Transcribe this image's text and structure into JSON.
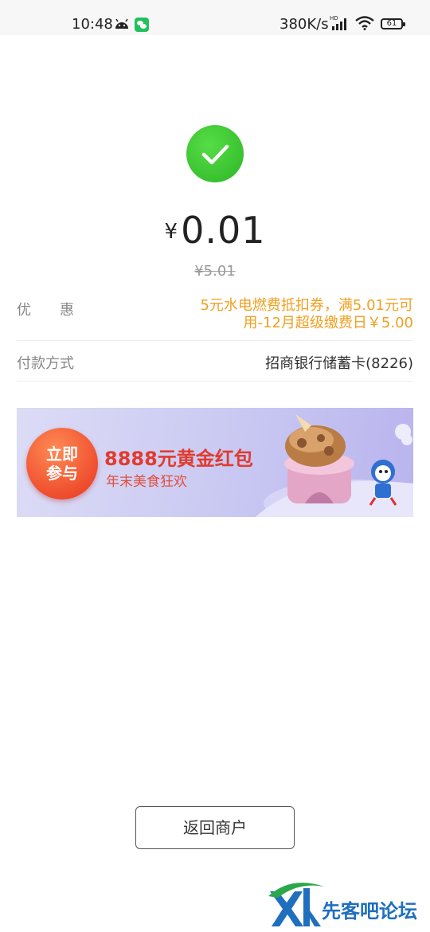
{
  "status_bar": {
    "time": "10:48",
    "network_speed": "380K/s",
    "battery": "61"
  },
  "payment": {
    "currency_symbol": "¥",
    "amount": "0.01",
    "original_amount": "¥5.01"
  },
  "discount": {
    "label": "优　　惠",
    "text": "5元水电燃费抵扣券，满5.01元可用-12月超级缴费日￥5.00"
  },
  "payment_method": {
    "label": "付款方式",
    "value": "招商银行储蓄卡(8226)"
  },
  "banner": {
    "button_text": "立即参与",
    "title": "8888元黄金红包",
    "subtitle": "年末美食狂欢"
  },
  "actions": {
    "return_label": "返回商户"
  },
  "watermark": {
    "text": "先客吧论坛"
  },
  "colors": {
    "success_green": "#2db527",
    "discount_orange": "#f0a020",
    "banner_red": "#e13b2e"
  },
  "icons": [
    "android-icon",
    "wechat-icon",
    "signal-icon",
    "wifi-icon",
    "battery-icon",
    "check-icon"
  ]
}
